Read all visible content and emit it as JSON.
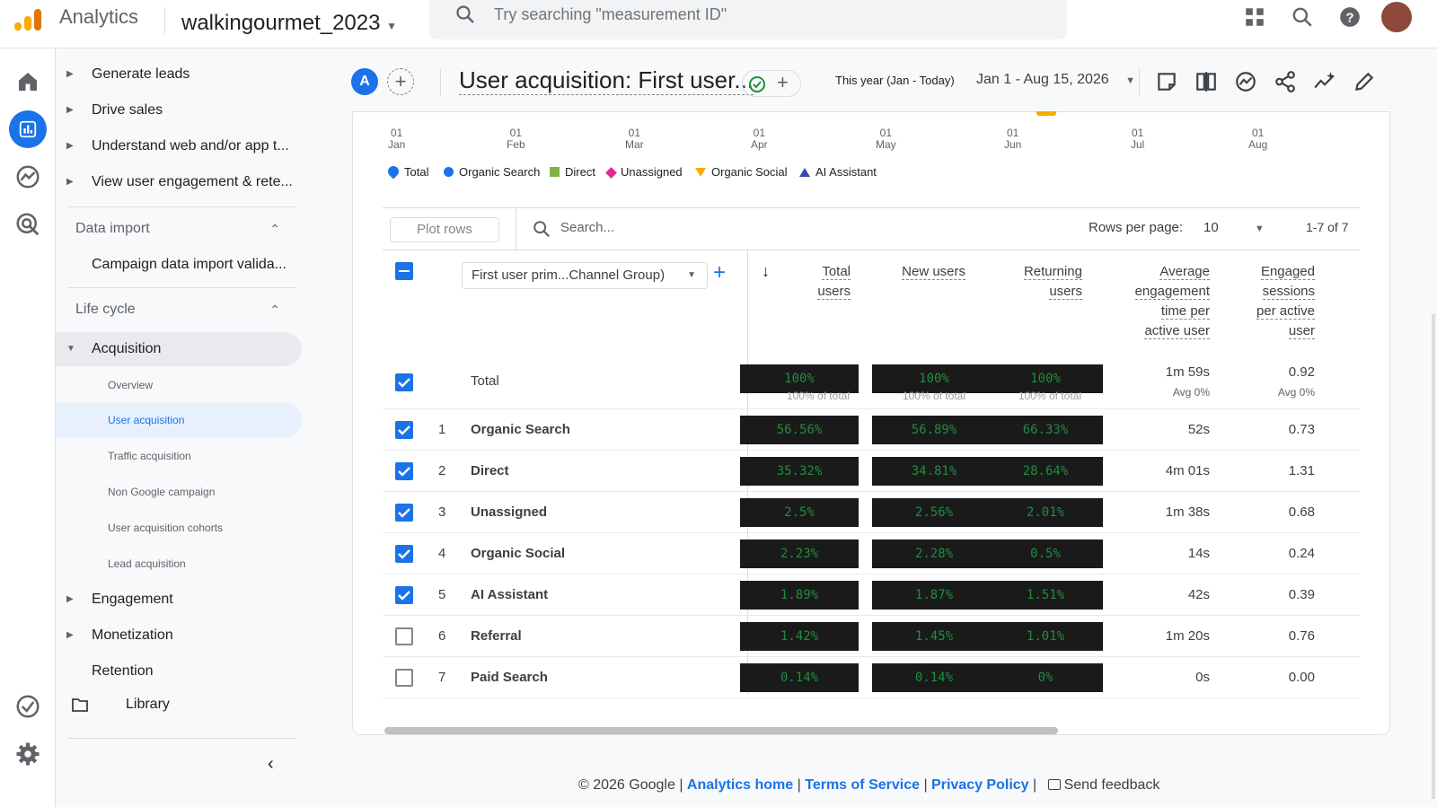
{
  "app": {
    "title": "Analytics",
    "property": "walkingourmet_2023",
    "search_placeholder": "Try searching \"measurement ID\""
  },
  "sidemenu": {
    "top_items": [
      "Generate leads",
      "Drive sales",
      "Understand web and/or app t...",
      "View user engagement & rete..."
    ],
    "data_import": {
      "header": "Data import",
      "items": [
        "Campaign data import valida..."
      ]
    },
    "life_cycle": {
      "header": "Life cycle",
      "acquisition": "Acquisition",
      "acquisition_items": [
        "Overview",
        "User acquisition",
        "Traffic acquisition",
        "Non Google campaign",
        "User acquisition cohorts",
        "Lead acquisition"
      ],
      "engagement": "Engagement",
      "monetization": "Monetization",
      "retention": "Retention"
    },
    "library": "Library"
  },
  "report": {
    "avatar": "A",
    "title": "User acquisition: First user...",
    "date_range_label": "This year (Jan - Today)",
    "date_range": "Jan 1 - Aug 15, 2026"
  },
  "chart": {
    "months": [
      [
        "01",
        "Jan"
      ],
      [
        "01",
        "Feb"
      ],
      [
        "01",
        "Mar"
      ],
      [
        "01",
        "Apr"
      ],
      [
        "01",
        "May"
      ],
      [
        "01",
        "Jun"
      ],
      [
        "01",
        "Jul"
      ],
      [
        "01",
        "Aug"
      ]
    ],
    "legend": [
      {
        "name": "Total",
        "color": "#1a73e8",
        "shape": "diamond-drop"
      },
      {
        "name": "Organic Search",
        "color": "#1a73e8",
        "shape": "circle"
      },
      {
        "name": "Direct",
        "color": "#7cb342",
        "shape": "square"
      },
      {
        "name": "Unassigned",
        "color": "#e52592",
        "shape": "diamond"
      },
      {
        "name": "Organic Social",
        "color": "#f9ab00",
        "shape": "triangle-down"
      },
      {
        "name": "AI Assistant",
        "color": "#3949ab",
        "shape": "triangle-up"
      }
    ]
  },
  "table": {
    "plot_rows": "Plot rows",
    "search_placeholder": "Search...",
    "rows_per_page_label": "Rows per page:",
    "rows_per_page": "10",
    "pager": "1-7 of 7",
    "dimension": "First user prim...Channel Group)",
    "columns": [
      [
        "Total",
        "users"
      ],
      [
        "New users"
      ],
      [
        "Returning",
        "users"
      ],
      [
        "Average",
        "engagement",
        "time per",
        "active user"
      ],
      [
        "Engaged",
        "sessions",
        "per active",
        "user"
      ]
    ],
    "total": {
      "label": "Total",
      "total_users": "100%",
      "total_users_sub": "100% of total",
      "new_users": "100%",
      "new_users_sub": "100% of total",
      "returning_users": "100%",
      "returning_users_sub": "100% of total",
      "avg_time": "1m 59s",
      "avg_time_sub": "Avg 0%",
      "sessions": "0.92",
      "sessions_sub": "Avg 0%"
    },
    "rows": [
      {
        "n": "1",
        "name": "Organic Search",
        "checked": true,
        "total_users": "56.56%",
        "new_users": "56.89%",
        "returning_users": "66.33%",
        "avg_time": "52s",
        "sessions": "0.73"
      },
      {
        "n": "2",
        "name": "Direct",
        "checked": true,
        "total_users": "35.32%",
        "new_users": "34.81%",
        "returning_users": "28.64%",
        "avg_time": "4m 01s",
        "sessions": "1.31"
      },
      {
        "n": "3",
        "name": "Unassigned",
        "checked": true,
        "total_users": "2.5%",
        "new_users": "2.56%",
        "returning_users": "2.01%",
        "avg_time": "1m 38s",
        "sessions": "0.68"
      },
      {
        "n": "4",
        "name": "Organic Social",
        "checked": true,
        "total_users": "2.23%",
        "new_users": "2.28%",
        "returning_users": "0.5%",
        "avg_time": "14s",
        "sessions": "0.24"
      },
      {
        "n": "5",
        "name": "AI Assistant",
        "checked": true,
        "total_users": "1.89%",
        "new_users": "1.87%",
        "returning_users": "1.51%",
        "avg_time": "42s",
        "sessions": "0.39"
      },
      {
        "n": "6",
        "name": "Referral",
        "checked": false,
        "total_users": "1.42%",
        "new_users": "1.45%",
        "returning_users": "1.01%",
        "avg_time": "1m 20s",
        "sessions": "0.76"
      },
      {
        "n": "7",
        "name": "Paid Search",
        "checked": false,
        "total_users": "0.14%",
        "new_users": "0.14%",
        "returning_users": "0%",
        "avg_time": "0s",
        "sessions": "0.00"
      }
    ]
  },
  "footer": {
    "copyright": "© 2026 Google |",
    "links": [
      "Analytics home",
      "Terms of Service",
      "Privacy Policy"
    ],
    "feedback": "Send feedback"
  }
}
